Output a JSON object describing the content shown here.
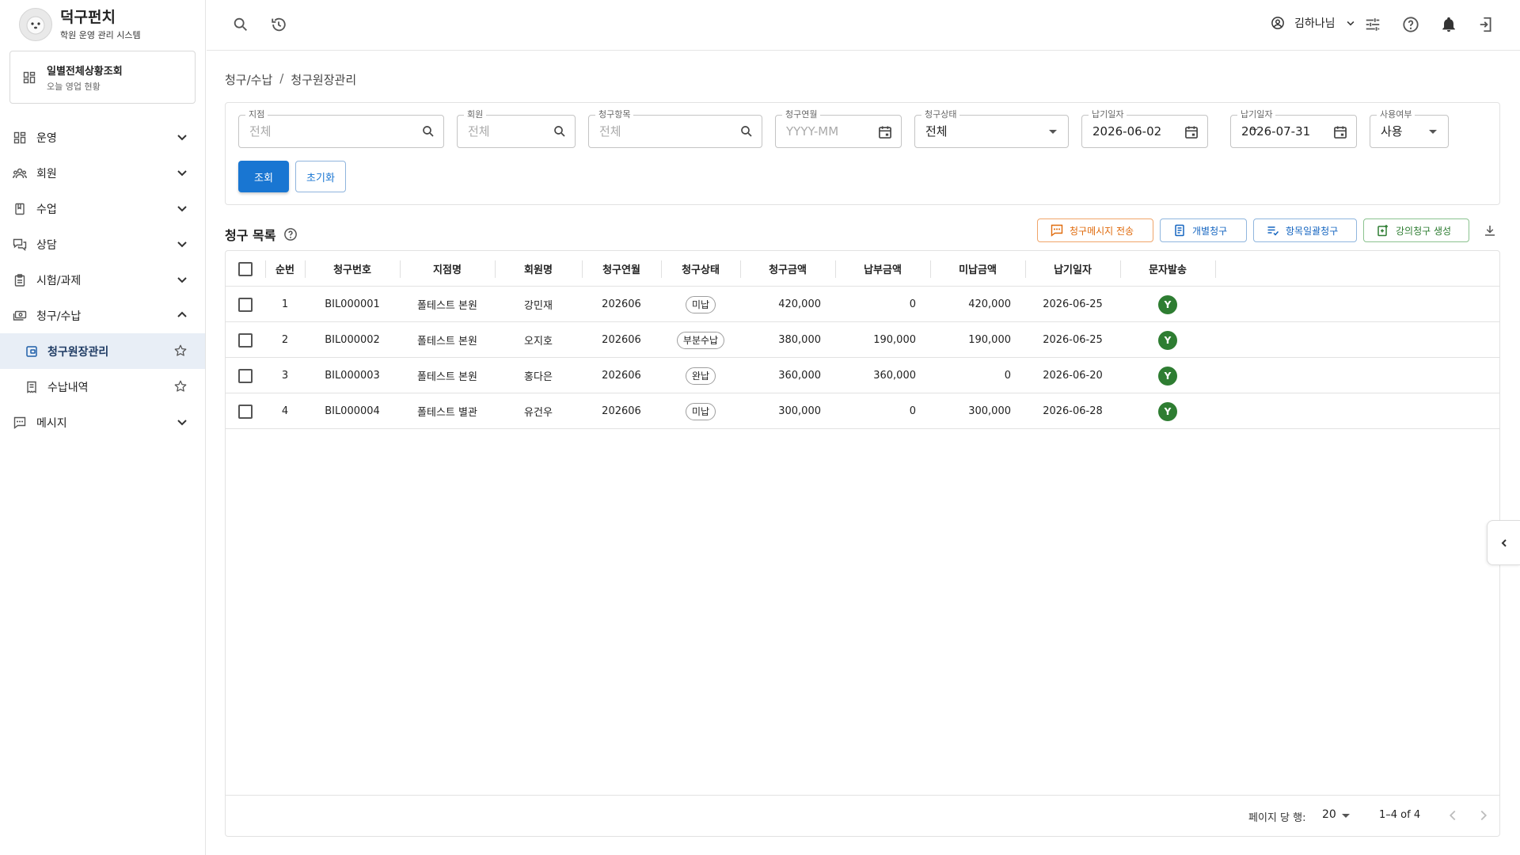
{
  "brand": {
    "title": "덕구펀치",
    "subtitle": "학원 운영 관리 시스템"
  },
  "shortcut": {
    "title": "일별전체상황조회",
    "subtitle": "오늘 영업 현황"
  },
  "nav": {
    "items": [
      {
        "label": "운영",
        "icon": "dashboard-icon"
      },
      {
        "label": "회원",
        "icon": "people-icon"
      },
      {
        "label": "수업",
        "icon": "book-icon"
      },
      {
        "label": "상담",
        "icon": "chat-icon"
      },
      {
        "label": "시험/과제",
        "icon": "clipboard-icon"
      },
      {
        "label": "청구/수납",
        "icon": "payments-icon"
      }
    ],
    "billing_sub": [
      {
        "label": "청구원장관리",
        "icon": "ledger-icon"
      },
      {
        "label": "수납내역",
        "icon": "receipt-icon"
      }
    ],
    "message": {
      "label": "메시지",
      "icon": "message-icon"
    }
  },
  "topbar": {
    "user_name": "김하나님"
  },
  "breadcrumb": {
    "parent": "청구/수납",
    "separator": "/",
    "current": "청구원장관리"
  },
  "filters": {
    "branch": {
      "label": "지점",
      "value": "전체"
    },
    "member": {
      "label": "회원",
      "value": "전체"
    },
    "item": {
      "label": "청구항목",
      "value": "전체"
    },
    "month": {
      "label": "청구연월",
      "placeholder": "YYYY-MM"
    },
    "status": {
      "label": "청구상태",
      "value": "전체"
    },
    "due_from": {
      "label": "납기일자",
      "value": "2026-06-02"
    },
    "tilde": "~",
    "due_to": {
      "label": "납기일자",
      "value": "2026-07-31"
    },
    "use": {
      "label": "사용여부",
      "value": "사용"
    },
    "search_button": "조회",
    "reset_button": "초기화"
  },
  "list": {
    "title": "청구 목록",
    "actions": {
      "send_message": "청구메시지 전송",
      "individual": "개별청구",
      "bulk_item": "항목일괄청구",
      "lecture": "강의청구 생성"
    },
    "columns": [
      "순번",
      "청구번호",
      "지점명",
      "회원명",
      "청구연월",
      "청구상태",
      "청구금액",
      "납부금액",
      "미납금액",
      "납기일자",
      "문자발송"
    ],
    "rows": [
      {
        "no": "1",
        "bill_no": "BIL000001",
        "branch": "폴테스트 본원",
        "member": "강민재",
        "month": "202606",
        "status": "미납",
        "amount": "420,000",
        "paid": "0",
        "unpaid": "420,000",
        "due": "2026-06-25",
        "sms": "Y"
      },
      {
        "no": "2",
        "bill_no": "BIL000002",
        "branch": "폴테스트 본원",
        "member": "오지호",
        "month": "202606",
        "status": "부분수납",
        "amount": "380,000",
        "paid": "190,000",
        "unpaid": "190,000",
        "due": "2026-06-25",
        "sms": "Y"
      },
      {
        "no": "3",
        "bill_no": "BIL000003",
        "branch": "폴테스트 본원",
        "member": "홍다은",
        "month": "202606",
        "status": "완납",
        "amount": "360,000",
        "paid": "360,000",
        "unpaid": "0",
        "due": "2026-06-20",
        "sms": "Y"
      },
      {
        "no": "4",
        "bill_no": "BIL000004",
        "branch": "폴테스트 별관",
        "member": "유건우",
        "month": "202606",
        "status": "미납",
        "amount": "300,000",
        "paid": "0",
        "unpaid": "300,000",
        "due": "2026-06-28",
        "sms": "Y"
      }
    ]
  },
  "pagination": {
    "rows_per_page_label": "페이지 당 행:",
    "rows_per_page": "20",
    "range": "1–4 of 4"
  },
  "colors": {
    "primary": "#1976d2",
    "orange": "#e06a0b",
    "green": "#2e7d32",
    "active_nav_bg": "#e8eef6"
  }
}
